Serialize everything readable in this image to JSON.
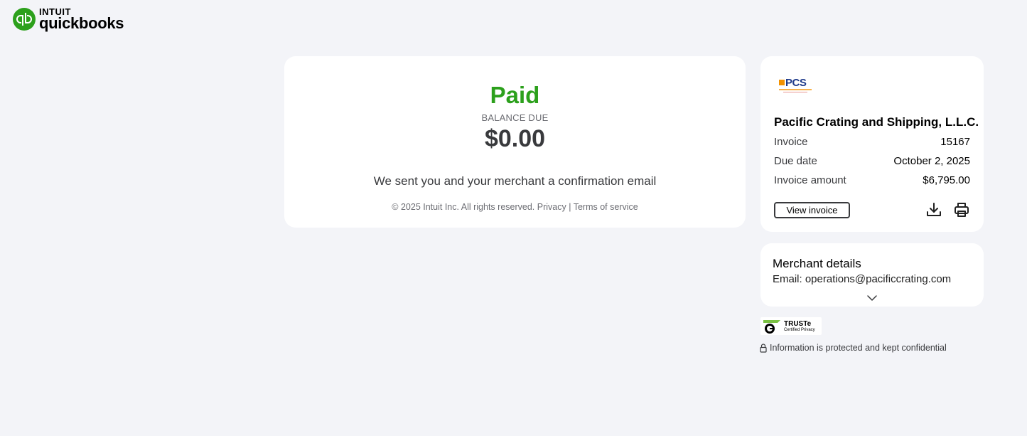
{
  "brand": {
    "top": "INTUIT",
    "bottom": "quickbooks",
    "color": "#2ca01c"
  },
  "status": {
    "label": "Paid",
    "balance_label": "BALANCE DUE",
    "balance_amount": "$0.00",
    "confirmation": "We sent you and your merchant a confirmation email"
  },
  "footer": {
    "copyright": "© 2025 Intuit Inc. All rights reserved.",
    "privacy": "Privacy",
    "separator": "|",
    "terms": "Terms of service"
  },
  "invoice": {
    "merchant_logo_text": "PCS",
    "merchant_name": "Pacific Crating and Shipping, L.L.C.",
    "invoice_label": "Invoice",
    "invoice_value": "15167",
    "due_label": "Due date",
    "due_value": "October 2, 2025",
    "amount_label": "Invoice amount",
    "amount_value": "$6,795.00",
    "view_button": "View invoice",
    "download_icon": "download-icon",
    "print_icon": "printer-icon"
  },
  "merchant_details": {
    "title": "Merchant details",
    "email": "Email: operations@pacificcrating.com",
    "expand_icon": "chevron-down-icon"
  },
  "trust": {
    "badge_title": "TRUSTe",
    "badge_subtitle": "Certified Privacy",
    "note": "Information is protected and kept confidential",
    "note_icon": "lock-icon"
  }
}
